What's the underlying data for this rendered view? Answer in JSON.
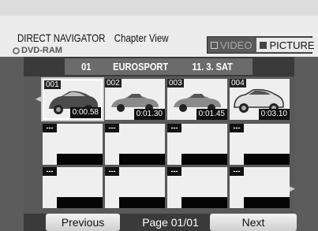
{
  "header": {
    "title": "DIRECT NAVIGATOR",
    "view": "Chapter View",
    "disc": "DVD-RAM",
    "toggle": {
      "video": "VIDEO",
      "picture": "PICTURE"
    }
  },
  "info": {
    "number": "01",
    "channel": "EUROSPORT",
    "date": "11. 3. SAT"
  },
  "chapters": [
    {
      "number": "001",
      "time": "0:00.58"
    },
    {
      "number": "002",
      "time": "0:01.30"
    },
    {
      "number": "003",
      "time": "0:01.45"
    },
    {
      "number": "004",
      "time": "0:03.10"
    }
  ],
  "empty_label": "---",
  "footer": {
    "previous": "Previous",
    "page": "Page 01/01",
    "next": "Next"
  }
}
